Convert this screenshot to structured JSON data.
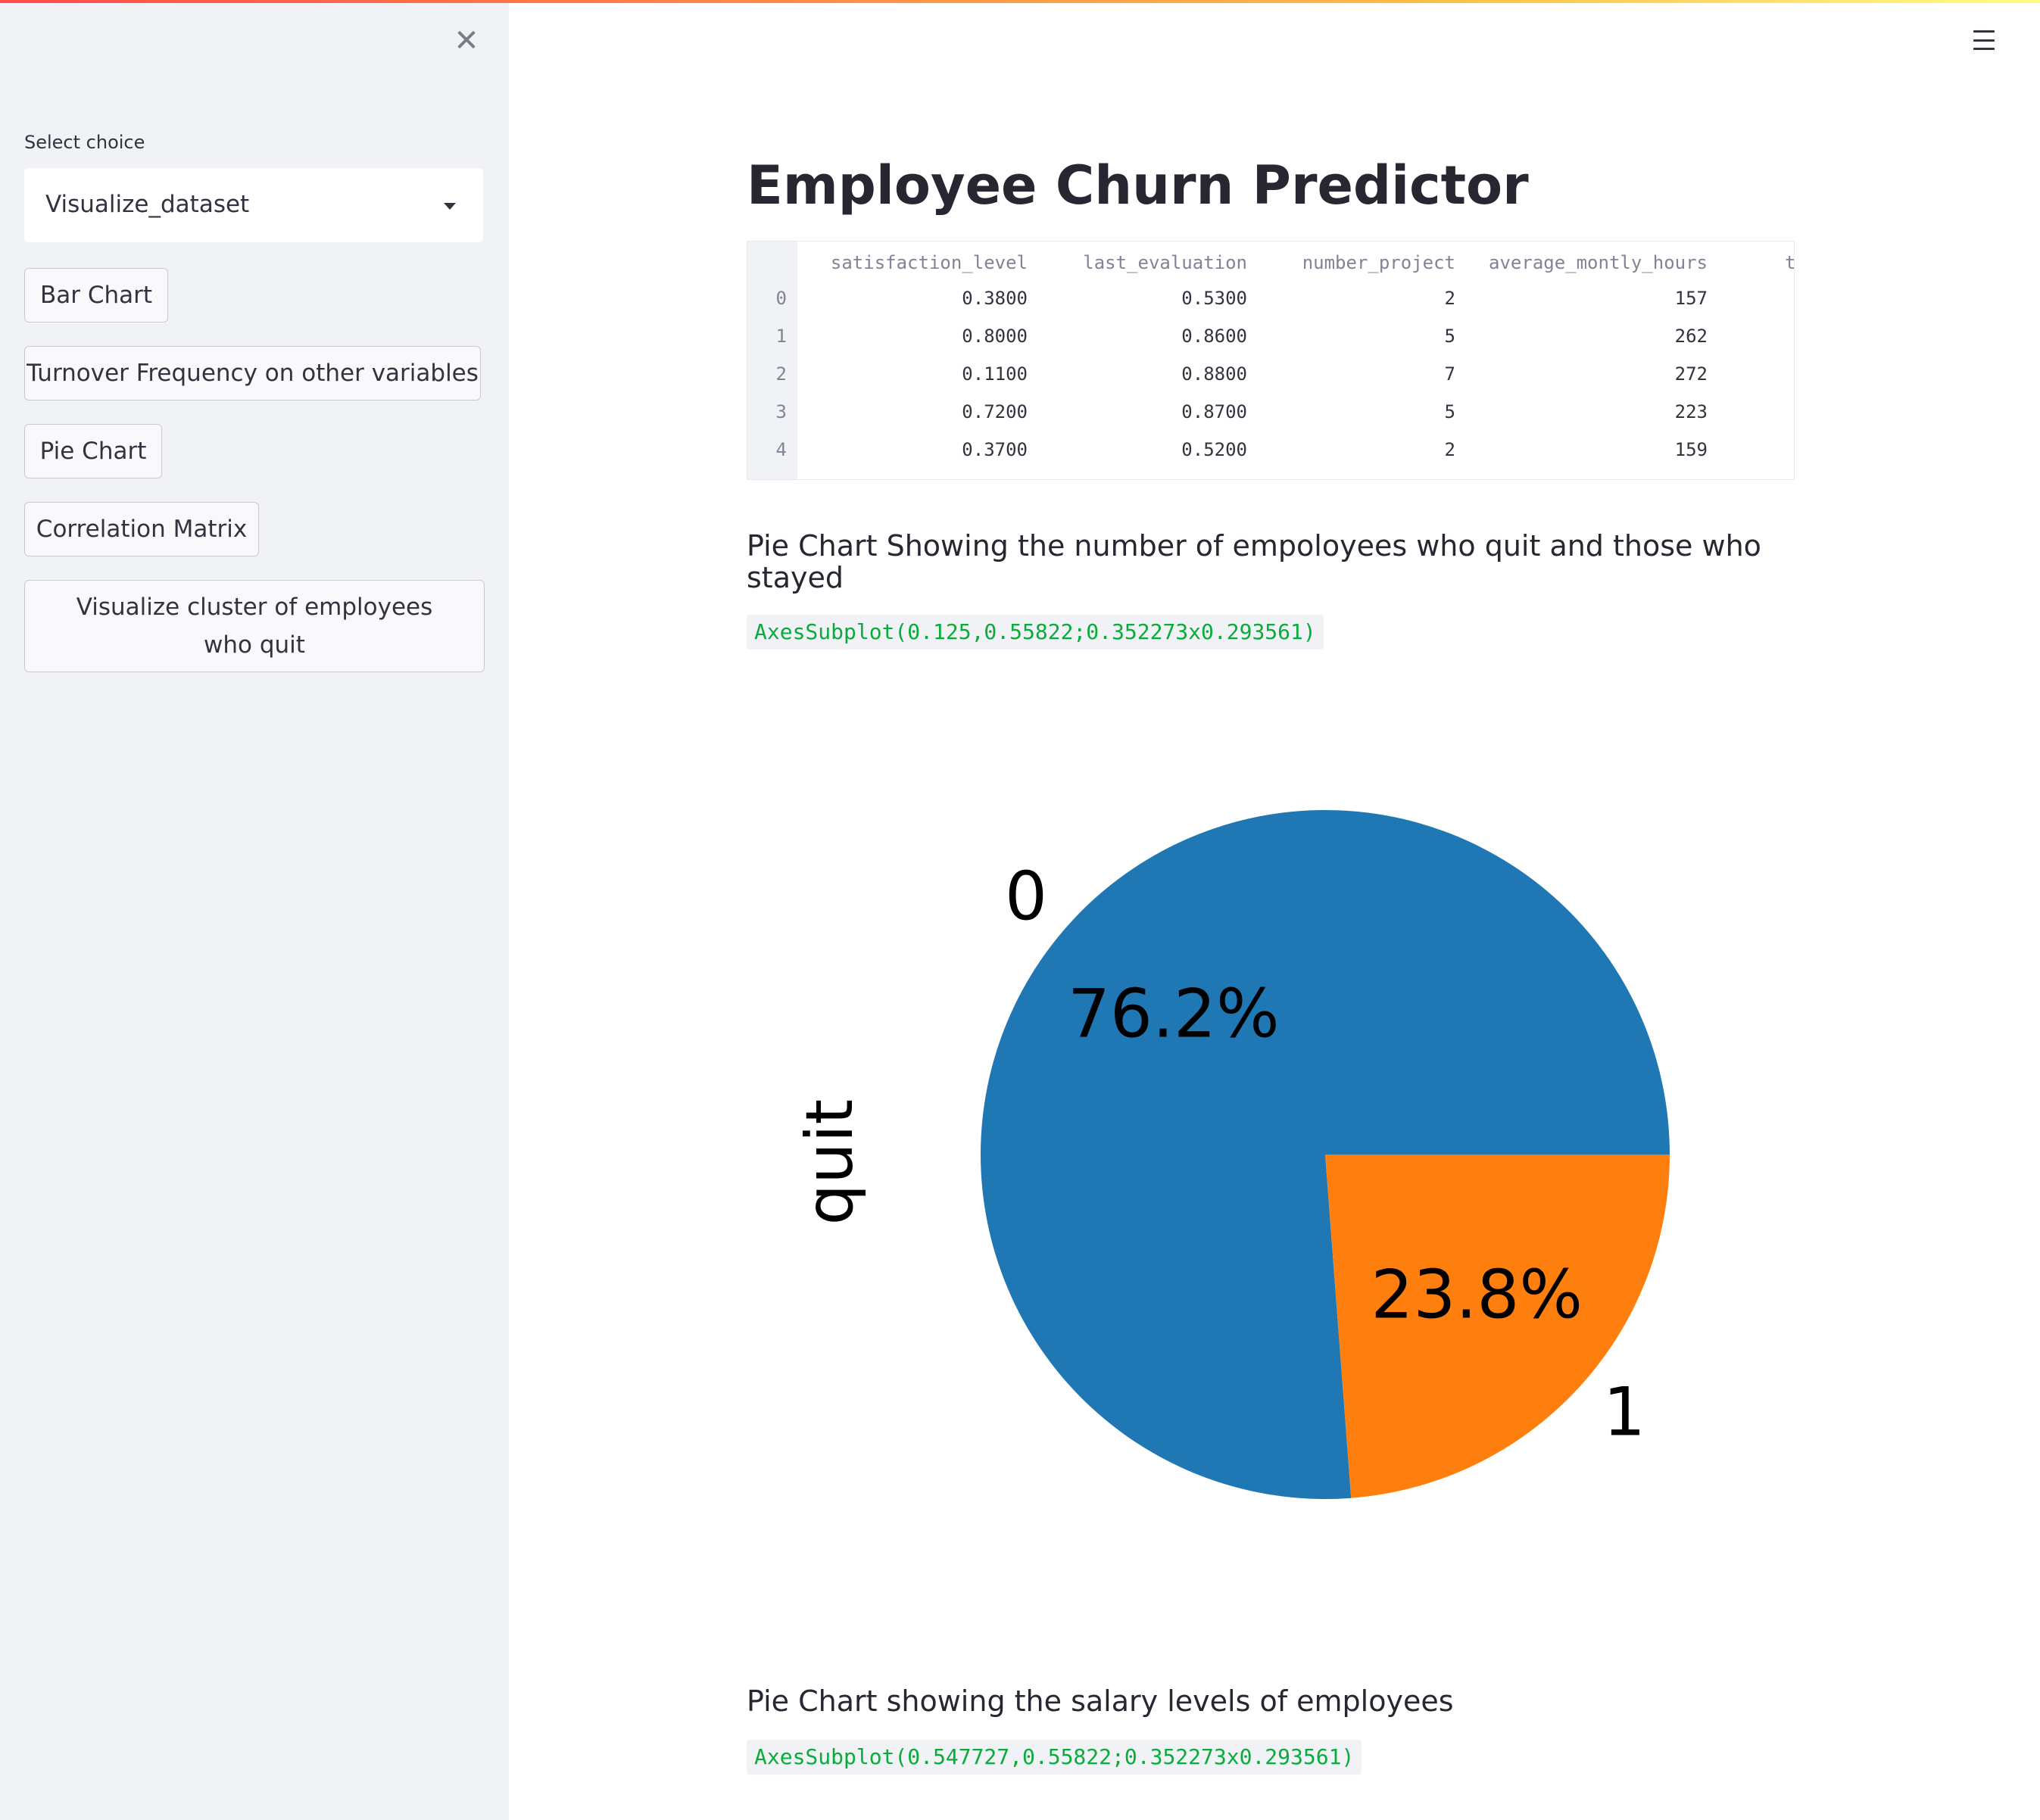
{
  "sidebar": {
    "select_label": "Select choice",
    "select_value": "Visualize_dataset",
    "buttons": [
      "Bar Chart",
      "Turnover Frequency on other variables",
      "Pie Chart",
      "Correlation Matrix",
      "Visualize cluster of employees who quit"
    ]
  },
  "main": {
    "title": "Employee Churn Predictor",
    "dataframe": {
      "columns": [
        "satisfaction_level",
        "last_evaluation",
        "number_project",
        "average_montly_hours",
        "t"
      ],
      "index": [
        "0",
        "1",
        "2",
        "3",
        "4"
      ],
      "rows": [
        [
          "0.3800",
          "0.5300",
          "2",
          "157"
        ],
        [
          "0.8000",
          "0.8600",
          "5",
          "262"
        ],
        [
          "0.1100",
          "0.8800",
          "7",
          "272"
        ],
        [
          "0.7200",
          "0.8700",
          "5",
          "223"
        ],
        [
          "0.3700",
          "0.5200",
          "2",
          "159"
        ]
      ]
    },
    "section1_heading": "Pie Chart Showing the number of empoloyees who quit and those who stayed",
    "section1_output": "AxesSubplot(0.125,0.55822;0.352273x0.293561)",
    "section2_heading": "Pie Chart showing the salary levels of employees",
    "section2_output": "AxesSubplot(0.547727,0.55822;0.352273x0.293561)"
  },
  "chart_data": {
    "type": "pie",
    "ylabel": "quit",
    "categories": [
      "0",
      "1"
    ],
    "values": [
      76.2,
      23.8
    ],
    "labels": [
      "76.2%",
      "23.8%"
    ],
    "colors": [
      "#1f77b4",
      "#ff7f0e"
    ]
  },
  "colors": {
    "accent_gradient": [
      "#ff4b4b",
      "#ffbd45",
      "#fffd80"
    ],
    "sidebar_bg": "#f0f2f6",
    "code_text": "#09ab3b"
  },
  "icons": {
    "close": "close-icon",
    "menu": "hamburger-menu-icon",
    "dropdown": "chevron-down-icon"
  }
}
